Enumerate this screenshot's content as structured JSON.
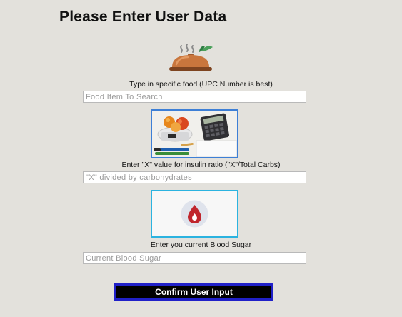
{
  "page": {
    "title": "Please Enter User Data"
  },
  "food": {
    "label": "Type in specific food (UPC Number is best)",
    "placeholder": "Food Item To Search",
    "value": ""
  },
  "insulin": {
    "label": "Enter \"X\" value for insulin ratio (\"X\"/Total Carbs)",
    "placeholder": "\"X\" divided by carbohydrates",
    "value": ""
  },
  "blood_sugar": {
    "label": "Enter you current Blood Sugar",
    "placeholder": "Current Blood Sugar",
    "value": ""
  },
  "confirm": {
    "label": "Confirm User Input"
  },
  "icons": {
    "food": "serving-cloche-icon",
    "nutrition": "nutrition-scale-calculator-photo",
    "blood": "blood-drop-icon"
  },
  "colors": {
    "background": "#e3e1dc",
    "photo_border": "#3d7fd6",
    "drop_border": "#2bb3e0",
    "drop_red": "#c0262d",
    "button_bg": "#000000",
    "button_border": "#2020c8"
  }
}
